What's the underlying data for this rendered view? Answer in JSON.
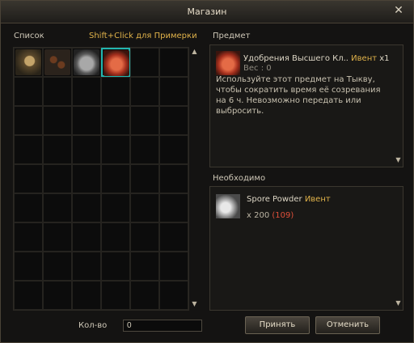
{
  "window": {
    "title": "Магазин"
  },
  "list": {
    "label": "Список",
    "hint": "Shift+Click для Примерки",
    "items": [
      {
        "icon": "sprayer-icon"
      },
      {
        "icon": "seeds-icon"
      },
      {
        "icon": "gray-bag-icon"
      },
      {
        "icon": "red-bag-icon",
        "selected": true
      }
    ]
  },
  "item": {
    "label": "Предмет",
    "name": "Удобрения Высшего Кл..",
    "tag": "Ивент",
    "count": "x1",
    "weight": "Вес : 0",
    "description": "Используйте этот предмет на Тыкву, чтобы сократить время её созревания на 6 ч. Невозможно передать или выбросить."
  },
  "required": {
    "label": "Необходимо",
    "name": "Spore Powder",
    "tag": "Ивент",
    "qty": "x 200",
    "owned": "(109)"
  },
  "quantity": {
    "label": "Кол-во",
    "value": "0"
  },
  "buttons": {
    "accept": "Принять",
    "cancel": "Отменить"
  },
  "colors": {
    "accent": "#e0b24a",
    "selection": "#22b6b0",
    "warning": "#e0503a"
  }
}
